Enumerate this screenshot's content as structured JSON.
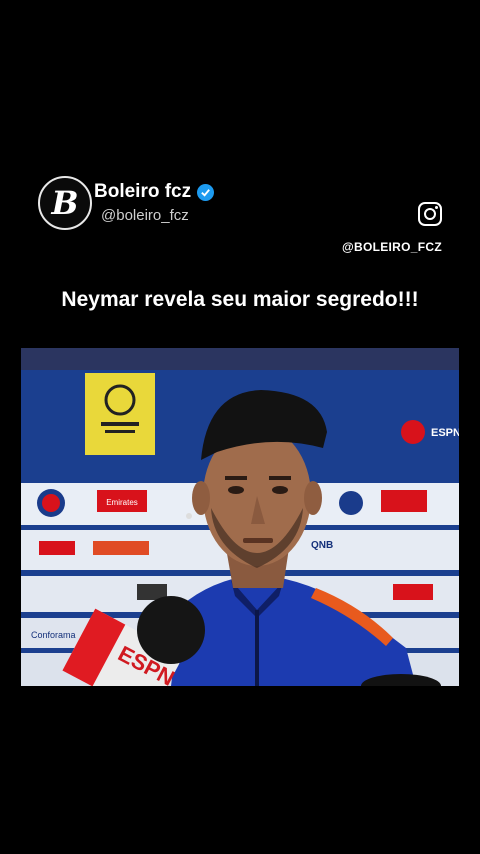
{
  "profile": {
    "name": "Boleiro fcz",
    "handle": "@boleiro_fcz",
    "avatar_letter": "B",
    "instagram_handle": "@BOLEIRO_FCZ"
  },
  "post": {
    "headline": "Neymar revela seu maior segredo!!!"
  },
  "video": {
    "banner_texts": [
      "Emirates",
      "QNB",
      "ESPN",
      "Conforama"
    ]
  },
  "colors": {
    "background": "#000000",
    "verified": "#1d9bf0",
    "backdrop_blue": "#1d3f8c"
  }
}
